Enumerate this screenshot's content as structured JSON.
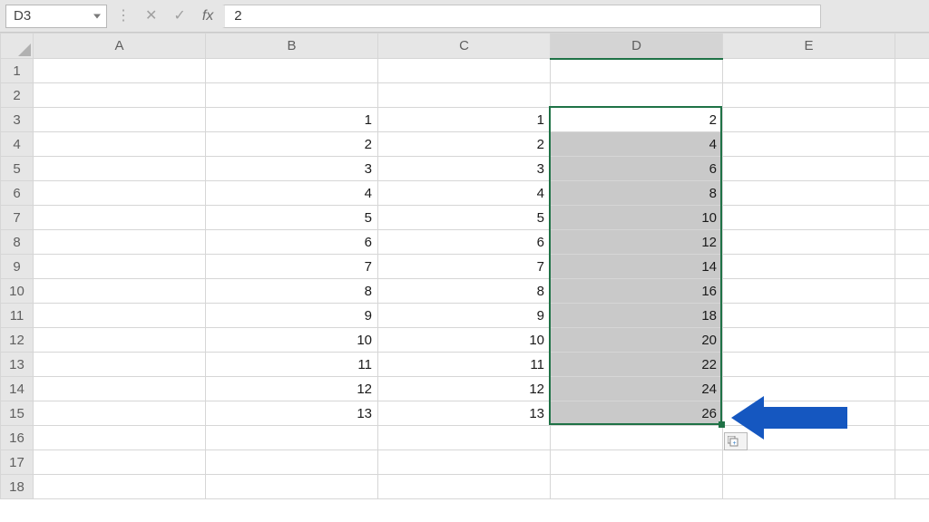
{
  "name_box": {
    "cell_ref": "D3"
  },
  "formula_bar": {
    "fx_label": "fx",
    "cancel_icon": "✕",
    "enter_icon": "✓",
    "value": "2"
  },
  "columns": [
    "A",
    "B",
    "C",
    "D",
    "E"
  ],
  "rows": [
    "1",
    "2",
    "3",
    "4",
    "5",
    "6",
    "7",
    "8",
    "9",
    "10",
    "11",
    "12",
    "13",
    "14",
    "15",
    "16",
    "17",
    "18"
  ],
  "grid": {
    "3": {
      "B": "1",
      "C": "1",
      "D": "2"
    },
    "4": {
      "B": "2",
      "C": "2",
      "D": "4"
    },
    "5": {
      "B": "3",
      "C": "3",
      "D": "6"
    },
    "6": {
      "B": "4",
      "C": "4",
      "D": "8"
    },
    "7": {
      "B": "5",
      "C": "5",
      "D": "10"
    },
    "8": {
      "B": "6",
      "C": "6",
      "D": "12"
    },
    "9": {
      "B": "7",
      "C": "7",
      "D": "14"
    },
    "10": {
      "B": "8",
      "C": "8",
      "D": "16"
    },
    "11": {
      "B": "9",
      "C": "9",
      "D": "18"
    },
    "12": {
      "B": "10",
      "C": "10",
      "D": "20"
    },
    "13": {
      "B": "11",
      "C": "11",
      "D": "22"
    },
    "14": {
      "B": "12",
      "C": "12",
      "D": "24"
    },
    "15": {
      "B": "13",
      "C": "13",
      "D": "26"
    }
  },
  "selection": {
    "active_cell": "D3",
    "range_start_row": 3,
    "range_end_row": 15,
    "range_col": "D"
  },
  "annotation": {
    "color": "#1557c0"
  }
}
